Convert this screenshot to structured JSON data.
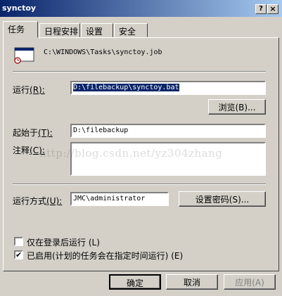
{
  "window": {
    "title": "synctoy",
    "help_glyph": "?",
    "close_glyph": "×"
  },
  "tabs": [
    {
      "label": "任务"
    },
    {
      "label": "日程安排"
    },
    {
      "label": "设置"
    },
    {
      "label": "安全"
    }
  ],
  "task": {
    "job_path": "C:\\WINDOWS\\Tasks\\synctoy.job",
    "run_label": "运行",
    "run_hotkey": "(R):",
    "run_value": "D:\\filebackup\\synctoy.bat",
    "browse_label": "浏览",
    "browse_hotkey": "(B)...",
    "start_in_label": "起始于",
    "start_in_hotkey": "(T):",
    "start_in_value": "D:\\filebackup",
    "comment_label": "注释",
    "comment_hotkey": "(C):",
    "comment_value": "",
    "run_as_label": "运行方式",
    "run_as_hotkey": "(U):",
    "run_as_value": "JMC\\administrator",
    "set_password_label": "设置密码",
    "set_password_hotkey": "(S)...",
    "only_logged_on_label": "仅在登录后运行",
    "only_logged_on_hotkey": "(L)",
    "only_logged_on_checked": false,
    "enabled_label": "已启用(计划的任务会在指定时间运行)",
    "enabled_hotkey": "(E)",
    "enabled_checked": true
  },
  "watermark": "http://blog.csdn.net/yz304zhang",
  "buttons": {
    "ok": "确定",
    "cancel": "取消",
    "apply_label": "应用",
    "apply_hotkey": "(A)"
  },
  "check_glyph": "✔"
}
